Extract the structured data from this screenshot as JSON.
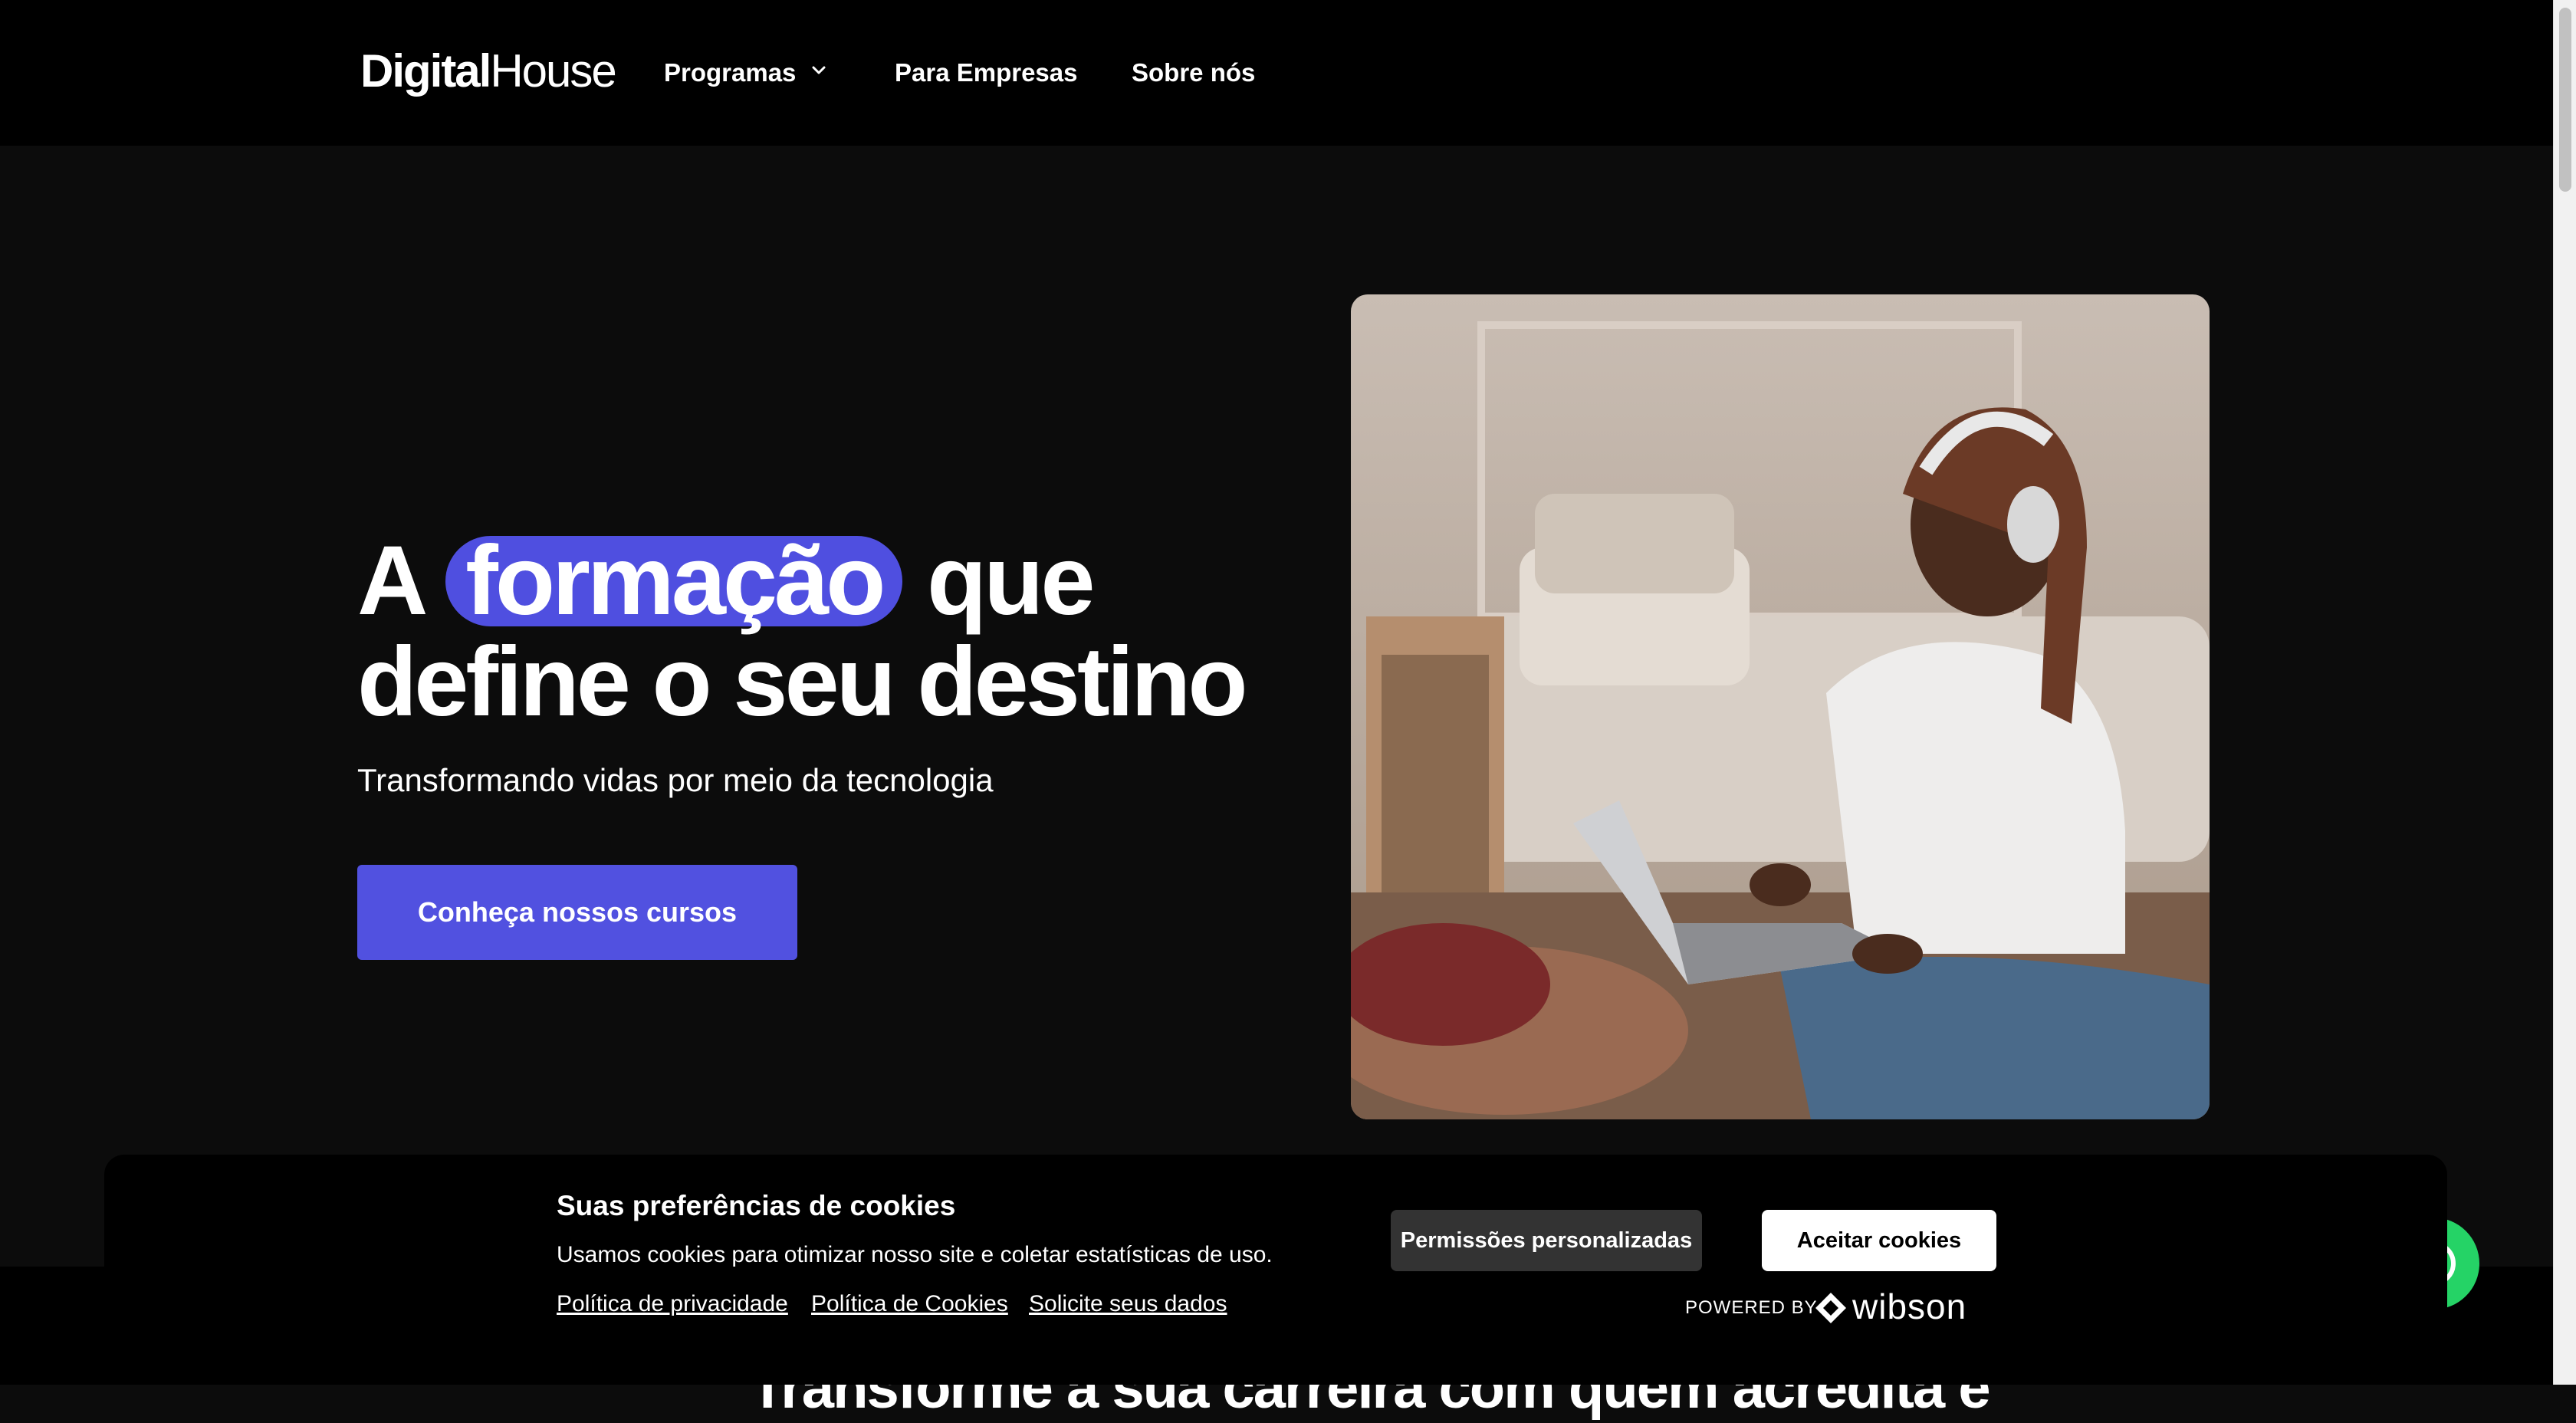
{
  "nav": {
    "logo_part1": "Digital",
    "logo_part2": "House",
    "programas": "Programas",
    "empresas": "Para Empresas",
    "sobre": "Sobre nós"
  },
  "hero": {
    "title_a": "A",
    "title_highlight": "formação",
    "title_que": "que",
    "title_line2": "define o seu destino",
    "subtitle": "Transformando vidas por meio da tecnologia",
    "cta": "Conheça nossos cursos",
    "accent_color": "#5151e0"
  },
  "section2": {
    "title": "Transforme a sua carreira com quem acredita e"
  },
  "cookie": {
    "title": "Suas preferências de cookies",
    "description": "Usamos cookies para otimizar nosso site e coletar estatísticas de uso.",
    "link_privacy": "Política de privacidade",
    "link_cookies": "Política de Cookies",
    "link_data": "Solicite seus dados",
    "btn_permissions": "Permissões personalizadas",
    "btn_accept": "Aceitar cookies",
    "powered_by": "POWERED BY",
    "brand": "wibson"
  },
  "icons": {
    "chevron": "chevron-down-icon",
    "whatsapp": "whatsapp-icon",
    "wibson": "wibson-logo-icon"
  }
}
